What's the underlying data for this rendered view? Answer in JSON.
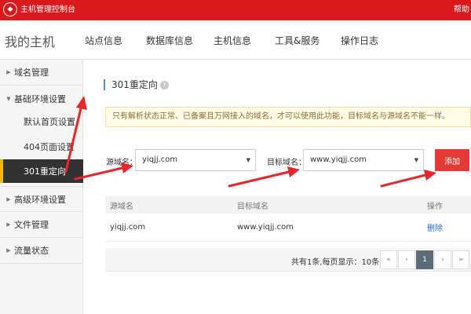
{
  "topbar": {
    "title": "主机管理控制台",
    "help": "帮助"
  },
  "navbar": {
    "brand": "我的主机",
    "items": [
      "站点信息",
      "数据库信息",
      "主机信息",
      "工具&服务",
      "操作日志"
    ]
  },
  "sidebar": {
    "items": [
      {
        "label": "域名管理"
      },
      {
        "label": "基础环境设置"
      },
      {
        "label": "默认首页设置"
      },
      {
        "label": "404页面设置"
      },
      {
        "label": "301重定向"
      },
      {
        "label": "高级环境设置"
      },
      {
        "label": "文件管理"
      },
      {
        "label": "流量状态"
      }
    ]
  },
  "page": {
    "title": "301重定向",
    "help_icon": "question-icon"
  },
  "notice": "只有解析状态正常、已备案且万网接入的域名，才可以使用此功能，目标域名与源域名不能一样。",
  "form": {
    "source_label": "源域名：",
    "source_value": "yiqjj.com",
    "target_label": "目标域名：",
    "target_value": "www.yiqjj.com",
    "add_label": "添加"
  },
  "table": {
    "headers": [
      "源域名",
      "目标域名",
      "操作"
    ],
    "rows": [
      {
        "source": "yiqjj.com",
        "target": "www.yiqjj.com",
        "action": "删除"
      }
    ]
  },
  "pager": {
    "summary": "共有1条,每页显示：10条",
    "first": "«",
    "prev": "‹",
    "current": "1",
    "next": "›",
    "last": "»"
  },
  "colors": {
    "brand": "#d9191b",
    "accent": "#e33a36",
    "active_marker": "#f2b800",
    "annotation": "#e8262a"
  }
}
